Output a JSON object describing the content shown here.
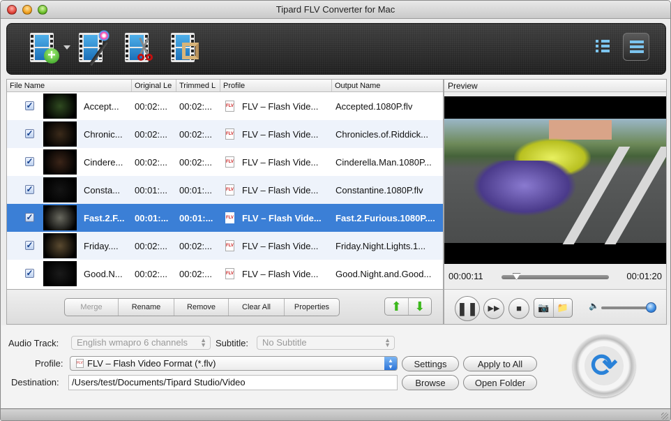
{
  "window": {
    "title": "Tipard FLV Converter for Mac"
  },
  "toolbar": {
    "buttons": [
      {
        "name": "add-video",
        "icon": "film-plus-icon"
      },
      {
        "name": "edit-effect",
        "icon": "film-magic-wand-icon"
      },
      {
        "name": "trim",
        "icon": "film-scissors-icon"
      },
      {
        "name": "crop",
        "icon": "film-crop-icon"
      }
    ],
    "view_modes": [
      {
        "name": "list-view",
        "icon": "list-icon",
        "active": false
      },
      {
        "name": "detail-view",
        "icon": "detail-list-icon",
        "active": true
      }
    ]
  },
  "file_list": {
    "columns": [
      "File Name",
      "Original Le",
      "Trimmed L",
      "Profile",
      "Output Name"
    ],
    "rows": [
      {
        "checked": true,
        "name": "Accept...",
        "original": "00:02:...",
        "trimmed": "00:02:...",
        "profile": "FLV – Flash Vide...",
        "output": "Accepted.1080P.flv",
        "selected": false
      },
      {
        "checked": true,
        "name": "Chronic...",
        "original": "00:02:...",
        "trimmed": "00:02:...",
        "profile": "FLV – Flash Vide...",
        "output": "Chronicles.of.Riddick...",
        "selected": false
      },
      {
        "checked": true,
        "name": "Cindere...",
        "original": "00:02:...",
        "trimmed": "00:02:...",
        "profile": "FLV – Flash Vide...",
        "output": "Cinderella.Man.1080P...",
        "selected": false
      },
      {
        "checked": true,
        "name": "Consta...",
        "original": "00:01:...",
        "trimmed": "00:01:...",
        "profile": "FLV – Flash Vide...",
        "output": "Constantine.1080P.flv",
        "selected": false
      },
      {
        "checked": true,
        "name": "Fast.2.F...",
        "original": "00:01:...",
        "trimmed": "00:01:...",
        "profile": "FLV – Flash Vide...",
        "output": "Fast.2.Furious.1080P....",
        "selected": true
      },
      {
        "checked": true,
        "name": "Friday....",
        "original": "00:02:...",
        "trimmed": "00:02:...",
        "profile": "FLV – Flash Vide...",
        "output": "Friday.Night.Lights.1...",
        "selected": false
      },
      {
        "checked": true,
        "name": "Good.N...",
        "original": "00:02:...",
        "trimmed": "00:02:...",
        "profile": "FLV – Flash Vide...",
        "output": "Good.Night.and.Good...",
        "selected": false
      }
    ],
    "file_icon_label": "FLV",
    "check_glyph": "✓",
    "buttons": {
      "merge": "Merge",
      "rename": "Rename",
      "remove": "Remove",
      "clear_all": "Clear All",
      "properties": "Properties"
    },
    "move_up_icon": "⬆",
    "move_down_icon": "⬇"
  },
  "preview": {
    "title": "Preview",
    "current_time": "00:00:11",
    "total_time": "00:01:20",
    "progress": 0.14,
    "volume": 0.95,
    "icons": {
      "pause": "❚❚",
      "fast_forward": "▶▶",
      "stop": "■",
      "snapshot": "📷",
      "folder": "📁",
      "volume": "🔈"
    }
  },
  "settings": {
    "audio_track_label": "Audio Track:",
    "audio_track_value": "English wmapro 6 channels",
    "subtitle_label": "Subtitle:",
    "subtitle_value": "No Subtitle",
    "profile_label": "Profile:",
    "profile_value": "FLV – Flash Video Format (*.flv)",
    "destination_label": "Destination:",
    "destination_value": "/Users/test/Documents/Tipard Studio/Video",
    "settings_button": "Settings",
    "apply_all_button": "Apply to All",
    "browse_button": "Browse",
    "open_folder_button": "Open Folder",
    "stepper_glyph": "▲\n▼",
    "convert_glyph": "⟳"
  },
  "colors": {
    "selection": "#3b7fd6",
    "accent_blue": "#2a82d8",
    "arrow_green": "#3cb81c"
  }
}
